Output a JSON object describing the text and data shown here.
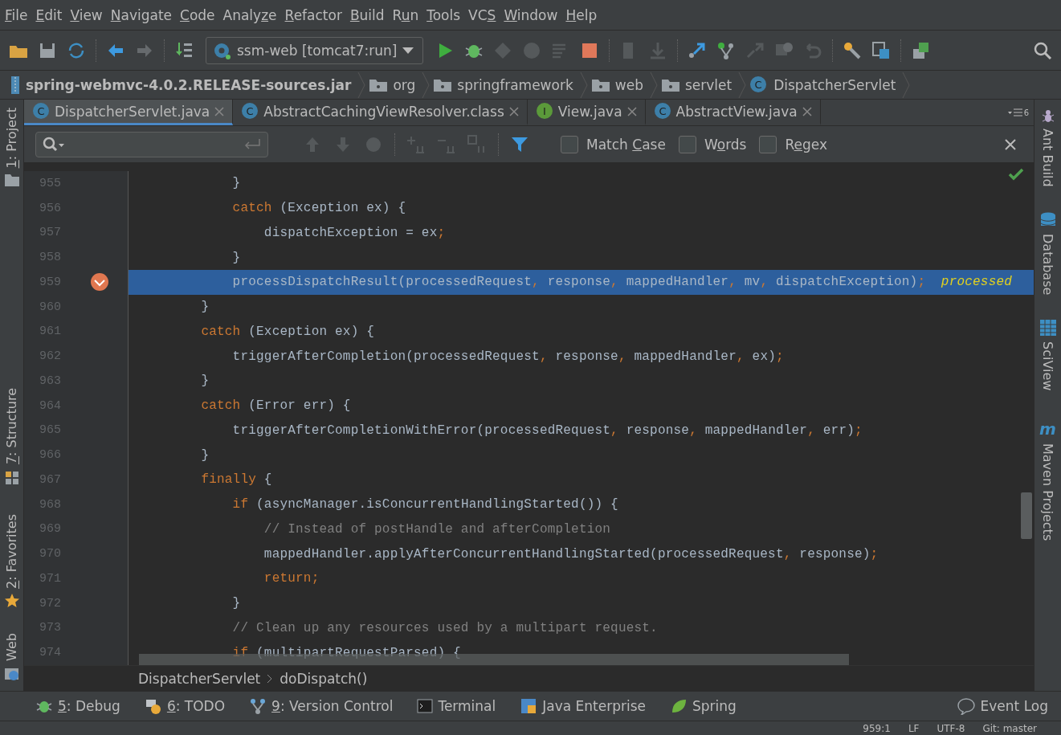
{
  "menu": [
    {
      "key": "F",
      "post": "ile"
    },
    {
      "key": "E",
      "post": "dit"
    },
    {
      "key": "V",
      "post": "iew"
    },
    {
      "key": "N",
      "post": "avigate"
    },
    {
      "key": "C",
      "post": "ode"
    },
    {
      "pre": "Analy",
      "key": "z",
      "post": "e"
    },
    {
      "key": "R",
      "post": "efactor"
    },
    {
      "key": "B",
      "post": "uild"
    },
    {
      "pre": "R",
      "key": "u",
      "post": "n"
    },
    {
      "key": "T",
      "post": "ools"
    },
    {
      "pre": "VC",
      "key": "S"
    },
    {
      "key": "W",
      "post": "indow"
    },
    {
      "key": "H",
      "post": "elp"
    }
  ],
  "run_config": {
    "label": "ssm-web [tomcat7:run]"
  },
  "breadcrumb": [
    {
      "kind": "jar",
      "label": "spring-webmvc-4.0.2.RELEASE-sources.jar"
    },
    {
      "kind": "package",
      "label": "org"
    },
    {
      "kind": "package",
      "label": "springframework"
    },
    {
      "kind": "package",
      "label": "web"
    },
    {
      "kind": "package",
      "label": "servlet"
    },
    {
      "kind": "class",
      "badge": "C",
      "label": "DispatcherServlet"
    }
  ],
  "tabs": [
    {
      "label": "DispatcherServlet.java",
      "kind": "class",
      "badge": "C",
      "selected": true
    },
    {
      "label": "AbstractCachingViewResolver.class",
      "kind": "class",
      "badge": "C",
      "selected": false
    },
    {
      "label": "View.java",
      "kind": "interface",
      "badge": "I",
      "selected": false
    },
    {
      "label": "AbstractView.java",
      "kind": "class",
      "badge": "C",
      "selected": false
    }
  ],
  "tab_count": "6",
  "search": {
    "options": [
      {
        "pre": "Match ",
        "key": "C",
        "post": "ase",
        "checked": false
      },
      {
        "pre": "W",
        "key": "o",
        "post": "rds",
        "checked": false
      },
      {
        "pre": "R",
        "key": "e",
        "post": "gex",
        "checked": false
      }
    ]
  },
  "left_tools": [
    {
      "key": "1",
      "post": ": Project"
    },
    {
      "key": "7",
      "post": ": Structure"
    },
    {
      "key": "2",
      "post": ": Favorites"
    },
    {
      "pre": "Web"
    }
  ],
  "right_tools": [
    {
      "label": "Ant Build"
    },
    {
      "label": "Database"
    },
    {
      "label": "SciView"
    },
    {
      "label": "Maven Projects",
      "badge": "m"
    }
  ],
  "code": [
    {
      "number": "955",
      "current": false,
      "tokens": [
        {
          "kind": "text",
          "text": "            }"
        }
      ]
    },
    {
      "number": "956",
      "current": false,
      "tokens": [
        {
          "kind": "kw",
          "text": "            catch"
        },
        {
          "kind": "text",
          "text": " (Exception ex) {"
        }
      ]
    },
    {
      "number": "957",
      "current": false,
      "tokens": [
        {
          "kind": "text",
          "text": "                dispatchException = ex"
        },
        {
          "kind": "punct",
          "text": ";"
        }
      ]
    },
    {
      "number": "958",
      "current": false,
      "tokens": [
        {
          "kind": "text",
          "text": "            }"
        }
      ]
    },
    {
      "number": "959",
      "current": true,
      "tokens": [
        {
          "kind": "text",
          "text": "            processDispatchResult(processedRequest"
        },
        {
          "kind": "punct",
          "text": ","
        },
        {
          "kind": "text",
          "text": " response"
        },
        {
          "kind": "punct",
          "text": ","
        },
        {
          "kind": "text",
          "text": " mappedHandler"
        },
        {
          "kind": "punct",
          "text": ","
        },
        {
          "kind": "text",
          "text": " mv"
        },
        {
          "kind": "punct",
          "text": ","
        },
        {
          "kind": "text",
          "text": " dispatchException)"
        },
        {
          "kind": "punct",
          "text": ";"
        },
        {
          "kind": "hint",
          "text": "  processed"
        }
      ]
    },
    {
      "number": "960",
      "current": false,
      "tokens": [
        {
          "kind": "text",
          "text": "        }"
        }
      ]
    },
    {
      "number": "961",
      "current": false,
      "tokens": [
        {
          "kind": "kw",
          "text": "        catch"
        },
        {
          "kind": "text",
          "text": " (Exception ex) {"
        }
      ]
    },
    {
      "number": "962",
      "current": false,
      "tokens": [
        {
          "kind": "text",
          "text": "            triggerAfterCompletion(processedRequest"
        },
        {
          "kind": "punct",
          "text": ","
        },
        {
          "kind": "text",
          "text": " response"
        },
        {
          "kind": "punct",
          "text": ","
        },
        {
          "kind": "text",
          "text": " mappedHandler"
        },
        {
          "kind": "punct",
          "text": ","
        },
        {
          "kind": "text",
          "text": " ex)"
        },
        {
          "kind": "punct",
          "text": ";"
        }
      ]
    },
    {
      "number": "963",
      "current": false,
      "tokens": [
        {
          "kind": "text",
          "text": "        }"
        }
      ]
    },
    {
      "number": "964",
      "current": false,
      "tokens": [
        {
          "kind": "kw",
          "text": "        catch"
        },
        {
          "kind": "text",
          "text": " (Error err) {"
        }
      ]
    },
    {
      "number": "965",
      "current": false,
      "tokens": [
        {
          "kind": "text",
          "text": "            triggerAfterCompletionWithError(processedRequest"
        },
        {
          "kind": "punct",
          "text": ","
        },
        {
          "kind": "text",
          "text": " response"
        },
        {
          "kind": "punct",
          "text": ","
        },
        {
          "kind": "text",
          "text": " mappedHandler"
        },
        {
          "kind": "punct",
          "text": ","
        },
        {
          "kind": "text",
          "text": " err)"
        },
        {
          "kind": "punct",
          "text": ";"
        }
      ]
    },
    {
      "number": "966",
      "current": false,
      "tokens": [
        {
          "kind": "text",
          "text": "        }"
        }
      ]
    },
    {
      "number": "967",
      "current": false,
      "tokens": [
        {
          "kind": "kw",
          "text": "        finally"
        },
        {
          "kind": "text",
          "text": " {"
        }
      ]
    },
    {
      "number": "968",
      "current": false,
      "tokens": [
        {
          "kind": "kw",
          "text": "            if"
        },
        {
          "kind": "text",
          "text": " (asyncManager.isConcurrentHandlingStarted()) {"
        }
      ]
    },
    {
      "number": "969",
      "current": false,
      "tokens": [
        {
          "kind": "comment",
          "text": "                // Instead of postHandle and afterCompletion"
        }
      ]
    },
    {
      "number": "970",
      "current": false,
      "tokens": [
        {
          "kind": "text",
          "text": "                mappedHandler.applyAfterConcurrentHandlingStarted(processedRequest"
        },
        {
          "kind": "punct",
          "text": ","
        },
        {
          "kind": "text",
          "text": " response)"
        },
        {
          "kind": "punct",
          "text": ";"
        }
      ]
    },
    {
      "number": "971",
      "current": false,
      "tokens": [
        {
          "kind": "kw",
          "text": "                return"
        },
        {
          "kind": "punct",
          "text": ";"
        }
      ]
    },
    {
      "number": "972",
      "current": false,
      "tokens": [
        {
          "kind": "text",
          "text": "            }"
        }
      ]
    },
    {
      "number": "973",
      "current": false,
      "tokens": [
        {
          "kind": "comment",
          "text": "            // Clean up any resources used by a multipart request."
        }
      ]
    },
    {
      "number": "974",
      "current": false,
      "tokens": [
        {
          "kind": "kw",
          "text": "            if"
        },
        {
          "kind": "text",
          "text": " (multipartRequestParsed) {"
        }
      ]
    }
  ],
  "editor_breadcrumb": [
    "DispatcherServlet",
    "doDispatch()"
  ],
  "bottom_tools": [
    {
      "key": "5",
      "post": ": Debug"
    },
    {
      "key": "6",
      "post": ": TODO"
    },
    {
      "key": "9",
      "post": ": Version Control"
    },
    {
      "pre": "Terminal"
    },
    {
      "pre": "Java Enterprise"
    },
    {
      "pre": "Spring"
    }
  ],
  "event_log": "Event Log",
  "status_bar": [
    "959:1",
    "LF",
    "UTF-8",
    "Git: master"
  ]
}
